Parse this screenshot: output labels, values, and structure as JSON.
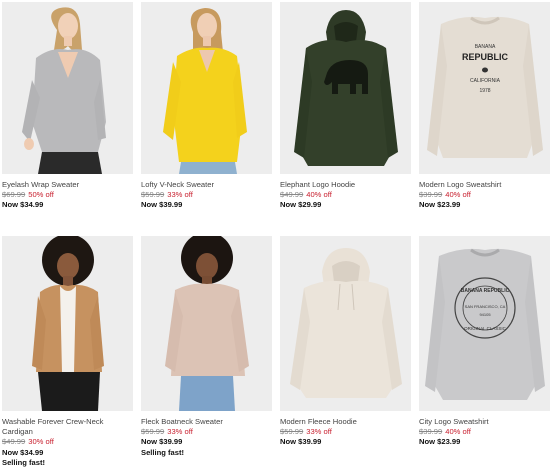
{
  "products": [
    {
      "name": "Eyelash Wrap Sweater",
      "orig_price": "$69.99",
      "discount": "50% off",
      "now": "Now $34.99",
      "badge": "",
      "image": "sweater-image"
    },
    {
      "name": "Lofty V-Neck Sweater",
      "orig_price": "$59.99",
      "discount": "33% off",
      "now": "Now $39.99",
      "badge": "",
      "image": "sweater-image"
    },
    {
      "name": "Elephant Logo Hoodie",
      "orig_price": "$49.99",
      "discount": "40% off",
      "now": "Now $29.99",
      "badge": "",
      "image": "hoodie-image"
    },
    {
      "name": "Modern Logo Sweatshirt",
      "orig_price": "$39.99",
      "discount": "40% off",
      "now": "Now $23.99",
      "badge": "",
      "image": "sweatshirt-image"
    },
    {
      "name": "Washable Forever Crew-Neck Cardigan",
      "orig_price": "$49.99",
      "discount": "30% off",
      "now": "Now $34.99",
      "badge": "Selling fast!",
      "image": "cardigan-image"
    },
    {
      "name": "Fleck Boatneck Sweater",
      "orig_price": "$59.99",
      "discount": "33% off",
      "now": "Now $39.99",
      "badge": "Selling fast!",
      "image": "sweater-image"
    },
    {
      "name": "Modern Fleece Hoodie",
      "orig_price": "$59.99",
      "discount": "33% off",
      "now": "Now $39.99",
      "badge": "",
      "image": "hoodie-image"
    },
    {
      "name": "City Logo Sweatshirt",
      "orig_price": "$39.99",
      "discount": "40% off",
      "now": "Now $23.99",
      "badge": "",
      "image": "sweatshirt-image"
    }
  ],
  "print_text": {
    "modern_logo": [
      "BANANA",
      "REPUBLIC",
      "CALIFORNIA",
      "1978"
    ],
    "city_logo": [
      "BANANA REPUBLIC",
      "SAN FRANCISCO, CA",
      "94105",
      "ORIGINAL CLASSIC"
    ]
  },
  "colors": {
    "discount": "#c8202f",
    "card_bg": "#ededed"
  }
}
